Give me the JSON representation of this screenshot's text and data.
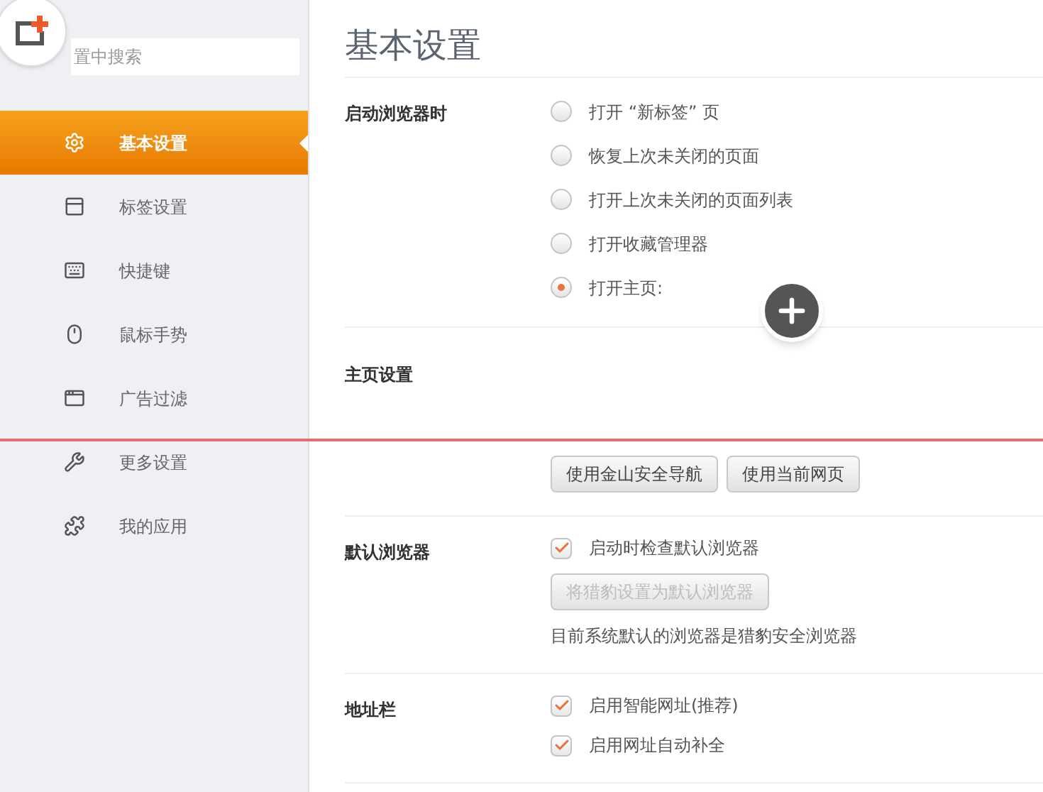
{
  "sidebar": {
    "search": {
      "placeholder": "置中搜索"
    },
    "items": [
      {
        "label": "基本设置",
        "selected": true
      },
      {
        "label": "标签设置",
        "selected": false
      },
      {
        "label": "快捷键",
        "selected": false
      },
      {
        "label": "鼠标手势",
        "selected": false
      },
      {
        "label": "广告过滤",
        "selected": false
      },
      {
        "label": "更多设置",
        "selected": false
      },
      {
        "label": "我的应用",
        "selected": false
      }
    ]
  },
  "title": "基本设置",
  "sections": [
    {
      "label": "启动浏览器时",
      "rows": [
        {
          "kind": "radio",
          "label": "打开 “新标签” 页",
          "selected": false
        },
        {
          "kind": "radio",
          "label": "恢复上次未关闭的页面",
          "selected": false
        },
        {
          "kind": "radio",
          "label": "打开上次未关闭的页面列表",
          "selected": false
        },
        {
          "kind": "radio",
          "label": "打开收藏管理器",
          "selected": false
        },
        {
          "kind": "radio",
          "label": "打开主页:",
          "selected": true
        }
      ]
    },
    {
      "label": "主页设置",
      "rows": [
        {
          "kind": "buttons",
          "buttons": [
            {
              "label": "使用金山安全导航",
              "disabled": false
            },
            {
              "label": "使用当前网页",
              "disabled": false
            }
          ]
        }
      ]
    },
    {
      "label": "默认浏览器",
      "rows": [
        {
          "kind": "checkbox",
          "label": "启动时检查默认浏览器",
          "checked": true
        },
        {
          "kind": "buttons",
          "buttons": [
            {
              "label": "将猎豹设置为默认浏览器",
              "disabled": true
            }
          ]
        },
        {
          "kind": "note",
          "label": "目前系统默认的浏览器是猎豹安全浏览器"
        }
      ]
    },
    {
      "label": "地址栏",
      "rows": [
        {
          "kind": "checkbox",
          "label": "启用智能网址(推荐)",
          "checked": true
        },
        {
          "kind": "checkbox",
          "label": "启用网址自动补全",
          "checked": true
        }
      ]
    }
  ]
}
